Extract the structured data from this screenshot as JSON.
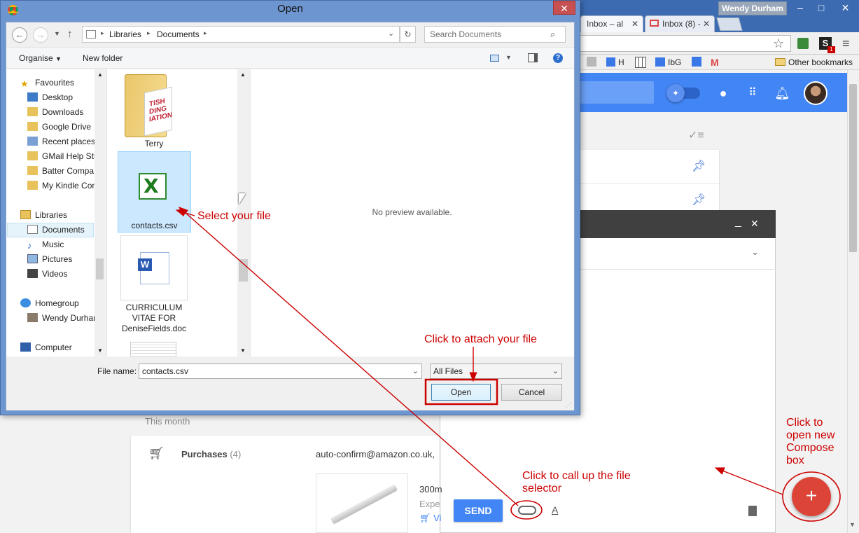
{
  "browser": {
    "profile_name": "Wendy Durham",
    "tabs": [
      {
        "label": "Inbox – al",
        "active": true
      },
      {
        "label": "Inbox (8) -",
        "active": false
      }
    ],
    "bookmarks": [
      "H",
      "IbG"
    ],
    "other_bookmarks": "Other bookmarks"
  },
  "inbox": {
    "this_month_label": "This month",
    "bundle_name": "Purchases",
    "bundle_count": "(4)",
    "bundle_sender": "auto-confirm@amazon.co.uk,",
    "product_title_partial": "300m",
    "product_sub_partial": "Expe",
    "product_link_partial": "Vi",
    "send_label": "SEND"
  },
  "dialog": {
    "title": "Open",
    "breadcrumb": [
      "Libraries",
      "Documents"
    ],
    "search_placeholder": "Search Documents",
    "organise_label": "Organise",
    "new_folder_label": "New folder",
    "nav": {
      "favourites_header": "Favourites",
      "favourites": [
        "Desktop",
        "Downloads",
        "Google Drive",
        "Recent places",
        "GMail Help Stu",
        "Batter Compa",
        "My Kindle Con"
      ],
      "libraries_header": "Libraries",
      "libraries": [
        "Documents",
        "Music",
        "Pictures",
        "Videos"
      ],
      "homegroup_header": "Homegroup",
      "homegroup": [
        "Wendy Durhan"
      ],
      "computer_header": "Computer"
    },
    "files": [
      {
        "name": "Terry",
        "type": "folder"
      },
      {
        "name": "contacts.csv",
        "type": "excel"
      },
      {
        "name": "CURRICULUM VITAE FOR DeniseFields.doc",
        "type": "word"
      }
    ],
    "folder_art_text": "TISH\nDING\nIATION",
    "no_preview": "No preview available.",
    "file_name_label": "File name:",
    "file_name_value": "contacts.csv",
    "file_type": "All Files",
    "open_label": "Open",
    "cancel_label": "Cancel"
  },
  "annotations": {
    "select_file": "Select your file",
    "attach_file": "Click to attach your file",
    "call_selector": "Click to call up the file selector",
    "open_compose": "Click to open new Compose box"
  },
  "colors": {
    "annotation_red": "#cc0000",
    "inbox_blue": "#4285f4",
    "fab_red": "#db4437",
    "dialog_frame": "#6d95cf"
  }
}
